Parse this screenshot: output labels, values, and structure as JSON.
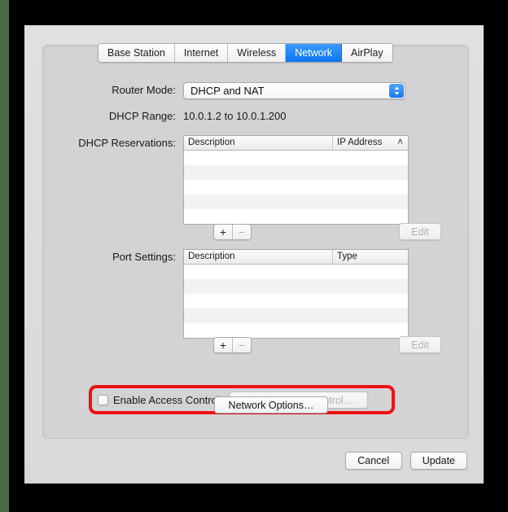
{
  "window": {
    "tabs": [
      {
        "label": "Base Station",
        "selected": false
      },
      {
        "label": "Internet",
        "selected": false
      },
      {
        "label": "Wireless",
        "selected": false
      },
      {
        "label": "Network",
        "selected": true
      },
      {
        "label": "AirPlay",
        "selected": false
      }
    ]
  },
  "router_mode": {
    "label": "Router Mode:",
    "value": "DHCP and NAT",
    "stepper_icon": "chevron-up-down-icon"
  },
  "dhcp_range": {
    "label": "DHCP Range:",
    "value": "10.0.1.2 to 10.0.1.200"
  },
  "dhcp_reservations": {
    "label": "DHCP Reservations:",
    "columns": [
      "Description",
      "IP Address"
    ],
    "sort_indicator": "˄",
    "rows": [],
    "add_label": "+",
    "remove_label": "−",
    "edit_label": "Edit"
  },
  "port_settings": {
    "label": "Port Settings:",
    "columns": [
      "Description",
      "Type"
    ],
    "rows": [],
    "add_label": "+",
    "remove_label": "−",
    "edit_label": "Edit"
  },
  "access_control": {
    "checkbox_label": "Enable Access Control:",
    "checked": false,
    "button_label": "Timed Access Control…"
  },
  "network_options": {
    "label": "Network Options…"
  },
  "actions": {
    "cancel_label": "Cancel",
    "update_label": "Update"
  },
  "colors": {
    "accent_blue": "#0a74f0",
    "highlight_red": "#ee1111",
    "desktop_green": "#4a6b48"
  }
}
